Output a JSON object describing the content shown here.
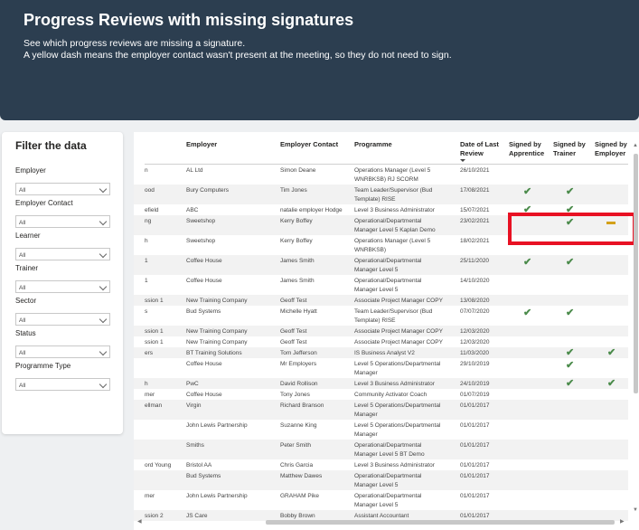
{
  "header": {
    "title": "Progress Reviews with missing signatures",
    "line1": "See which progress reviews are missing a signature.",
    "line2": "A yellow dash means the employer contact wasn't present at the meeting, so they do not need to sign."
  },
  "filters": {
    "title": "Filter the data",
    "items": [
      {
        "label": "Employer",
        "value": "All"
      },
      {
        "label": "Employer Contact",
        "value": "All"
      },
      {
        "label": "Learner",
        "value": "All"
      },
      {
        "label": "Trainer",
        "value": "All"
      },
      {
        "label": "Sector",
        "value": "All"
      },
      {
        "label": "Status",
        "value": "All"
      },
      {
        "label": "Programme Type",
        "value": "All"
      }
    ]
  },
  "table": {
    "headers": [
      "Employer",
      "Employer Contact",
      "Programme",
      "Date of Last Review",
      "Signed by Apprentice",
      "Signed by Trainer",
      "Signed by Employer"
    ],
    "rows": [
      {
        "c0": "n",
        "emp": "AL Ltd",
        "contact": "Simon Deane",
        "prog": [
          "Operations Manager (Level 5",
          "WNRBKSB) RJ SCORM"
        ],
        "date": "26/10/2021",
        "a": "",
        "t": "",
        "e": ""
      },
      {
        "c0": "ood",
        "emp": "Bury Computers",
        "contact": "Tim Jones",
        "prog": [
          "Team Leader/Supervisor   (Bud",
          "Template)   RISE"
        ],
        "date": "17/08/2021",
        "a": "check",
        "t": "check",
        "e": ""
      },
      {
        "c0": "efield",
        "emp": "ABC",
        "contact": "natalie employer Hodge",
        "prog": [
          "Level 3   Business Administrator"
        ],
        "date": "15/07/2021",
        "a": "check",
        "t": "check",
        "e": ""
      },
      {
        "c0": "ng",
        "emp": "Sweetshop",
        "contact": "Kerry Boffey",
        "prog": [
          "Operational/Departmental",
          "Manager Level 5   Kaplan Demo"
        ],
        "date": "23/02/2021",
        "a": "",
        "t": "check",
        "e": "dash"
      },
      {
        "c0": "h",
        "emp": "Sweetshop",
        "contact": "Kerry Boffey",
        "prog": [
          "Operations Manager (Level 5",
          "WNRBKSB)"
        ],
        "date": "18/02/2021",
        "a": "",
        "t": "",
        "e": ""
      },
      {
        "c0": "1",
        "emp": "Coffee House",
        "contact": "James Smith",
        "prog": [
          "Operational/Departmental",
          "Manager Level 5"
        ],
        "date": "25/11/2020",
        "a": "check",
        "t": "check",
        "e": ""
      },
      {
        "c0": "1",
        "emp": "Coffee House",
        "contact": "James Smith",
        "prog": [
          "Operational/Departmental",
          "Manager Level 5"
        ],
        "date": "14/10/2020",
        "a": "",
        "t": "",
        "e": ""
      },
      {
        "c0": "ssion 1",
        "emp": "New Training Company",
        "contact": "Geoff Test",
        "prog": [
          "Associate Project Manager   COPY"
        ],
        "date": "13/08/2020",
        "a": "",
        "t": "",
        "e": ""
      },
      {
        "c0": "s",
        "emp": "Bud Systems",
        "contact": "Michelle Hyatt",
        "prog": [
          "Team Leader/Supervisor   (Bud",
          "Template)   RISE"
        ],
        "date": "07/07/2020",
        "a": "check",
        "t": "check",
        "e": ""
      },
      {
        "c0": "ssion 1",
        "emp": "New Training Company",
        "contact": "Geoff Test",
        "prog": [
          "Associate Project Manager   COPY"
        ],
        "date": "12/03/2020",
        "a": "",
        "t": "",
        "e": ""
      },
      {
        "c0": "ssion 1",
        "emp": "New Training Company",
        "contact": "Geoff Test",
        "prog": [
          "Associate Project Manager   COPY"
        ],
        "date": "12/03/2020",
        "a": "",
        "t": "",
        "e": ""
      },
      {
        "c0": "ers",
        "emp": "BT Training Solutions",
        "contact": "Tom Jefferson",
        "prog": [
          "IS Business Analyst V2"
        ],
        "date": "11/03/2020",
        "a": "",
        "t": "check",
        "e": "check"
      },
      {
        "c0": "",
        "emp": "Coffee House",
        "contact": "Mr Employers",
        "prog": [
          "Level 5   Operations/Departmental",
          "Manager"
        ],
        "date": "29/10/2019",
        "a": "",
        "t": "check",
        "e": ""
      },
      {
        "c0": "h",
        "emp": "PwC",
        "contact": "David Rollison",
        "prog": [
          "Level 3   Business Administrator"
        ],
        "date": "24/10/2019",
        "a": "",
        "t": "check",
        "e": "check"
      },
      {
        "c0": "mer",
        "emp": "Coffee House",
        "contact": "Tony Jones",
        "prog": [
          "Community Activator Coach"
        ],
        "date": "01/07/2019",
        "a": "",
        "t": "",
        "e": ""
      },
      {
        "c0": "ellman",
        "emp": "Virgin",
        "contact": "Richard Branson",
        "prog": [
          "Level 5   Operations/Departmental",
          "Manager"
        ],
        "date": "01/01/2017",
        "a": "",
        "t": "",
        "e": ""
      },
      {
        "c0": "",
        "emp": "John Lewis Partnership",
        "contact": "Suzanne King",
        "prog": [
          "Level 5   Operations/Departmental",
          "Manager"
        ],
        "date": "01/01/2017",
        "a": "",
        "t": "",
        "e": ""
      },
      {
        "c0": "",
        "emp": "Smiths",
        "contact": "Peter Smith",
        "prog": [
          "Operational/Departmental",
          "Manager Level 5   BT Demo"
        ],
        "date": "01/01/2017",
        "a": "",
        "t": "",
        "e": ""
      },
      {
        "c0": "ord Young",
        "emp": "Bristol AA",
        "contact": "Chris Garcia",
        "prog": [
          "Level 3   Business Administrator"
        ],
        "date": "01/01/2017",
        "a": "",
        "t": "",
        "e": ""
      },
      {
        "c0": "",
        "emp": "Bud Systems",
        "contact": "Matthew Dawes",
        "prog": [
          "Operational/Departmental",
          "Manager Level 5"
        ],
        "date": "01/01/2017",
        "a": "",
        "t": "",
        "e": ""
      },
      {
        "c0": "mer",
        "emp": "John Lewis Partnership",
        "contact": "GRAHAM Pike",
        "prog": [
          "Operational/Departmental",
          "Manager Level 5"
        ],
        "date": "01/01/2017",
        "a": "",
        "t": "",
        "e": ""
      },
      {
        "c0": "ssion 2",
        "emp": "JS Care",
        "contact": "Bobby Brown",
        "prog": [
          "Assistant Accountant"
        ],
        "date": "01/01/2017",
        "a": "",
        "t": "",
        "e": ""
      }
    ]
  },
  "colors": {
    "header_bg": "#2c3e50",
    "check": "#4b8b4b",
    "dash": "#d3a018",
    "highlight": "#e81123"
  }
}
